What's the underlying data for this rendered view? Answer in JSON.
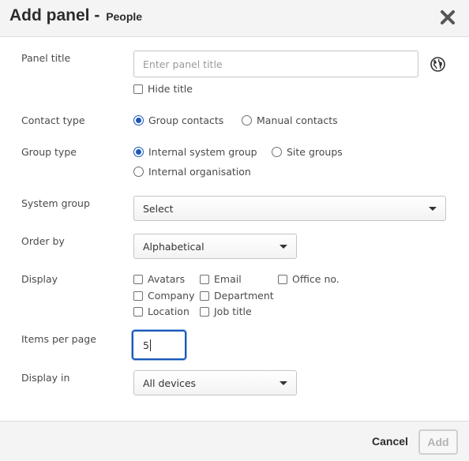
{
  "dialog": {
    "title": "Add panel -",
    "subtitle": "People",
    "close_icon": "close-icon"
  },
  "panel_title": {
    "label": "Panel title",
    "placeholder": "Enter panel title",
    "value": "",
    "globe_icon": "globe-icon",
    "hide_title": {
      "label": "Hide title",
      "checked": false
    }
  },
  "contact_type": {
    "label": "Contact type",
    "options": [
      {
        "label": "Group contacts",
        "selected": true
      },
      {
        "label": "Manual contacts",
        "selected": false
      }
    ]
  },
  "group_type": {
    "label": "Group type",
    "options": [
      {
        "label": "Internal system group",
        "selected": true
      },
      {
        "label": "Site groups",
        "selected": false
      },
      {
        "label": "Internal organisation",
        "selected": false
      }
    ]
  },
  "system_group": {
    "label": "System group",
    "value": "Select"
  },
  "order_by": {
    "label": "Order by",
    "value": "Alphabetical"
  },
  "display": {
    "label": "Display",
    "options": [
      {
        "label": "Avatars",
        "checked": false
      },
      {
        "label": "Email",
        "checked": false
      },
      {
        "label": "Office no.",
        "checked": false
      },
      {
        "label": "Company",
        "checked": false
      },
      {
        "label": "Department",
        "checked": false
      },
      {
        "label": "Location",
        "checked": false
      },
      {
        "label": "Job title",
        "checked": false
      }
    ]
  },
  "items_per_page": {
    "label": "Items per page",
    "value": "5"
  },
  "display_in": {
    "label": "Display in",
    "value": "All devices"
  },
  "footer": {
    "cancel_label": "Cancel",
    "add_label": "Add"
  },
  "colors": {
    "accent": "#1a58b8",
    "header_bg": "#f4f4f4",
    "disabled_text": "#b3b3b3"
  }
}
